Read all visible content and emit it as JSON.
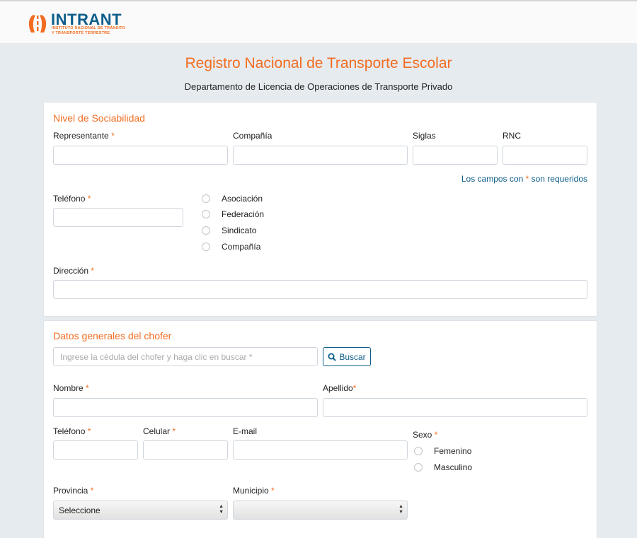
{
  "header": {
    "logo_text": "INTRANT",
    "logo_subtitle_1": "INSTITUTO NACIONAL DE TRÁNSITO",
    "logo_subtitle_2": "Y TRANSPORTE TERRESTRE"
  },
  "page": {
    "title": "Registro Nacional de Transporte Escolar",
    "subtitle": "Departamento de Licencia de Operaciones de Transporte Privado"
  },
  "section1": {
    "title": "Nivel de Sociabilidad",
    "representante_label": "Representante",
    "compania_label": "Compañía",
    "siglas_label": "Siglas",
    "rnc_label": "RNC",
    "required_note_a": "Los campos con",
    "required_note_star": "*",
    "required_note_b": "son requeridos",
    "telefono_label": "Teléfono",
    "type_options": [
      "Asociación",
      "Federación",
      "Sindicato",
      "Compañía"
    ],
    "direccion_label": "Dirección"
  },
  "section2": {
    "title": "Datos generales del chofer",
    "cedula_placeholder": "Ingrese la cédula del chofer y haga clic en buscar *",
    "buscar_label": "Buscar",
    "nombre_label": "Nombre",
    "apellido_label": "Apellido",
    "telefono_label": "Teléfono",
    "celular_label": "Celular",
    "email_label": "E-mail",
    "sexo_label": "Sexo",
    "sexo_options": [
      "Femenino",
      "Masculino"
    ],
    "provincia_label": "Provincia",
    "provincia_value": "Seleccione",
    "municipio_label": "Municipio",
    "municipio_value": ""
  },
  "required_mark": "*",
  "colors": {
    "accent": "#f26d21",
    "brand": "#0d5d8a",
    "background": "#e6ebf0"
  }
}
